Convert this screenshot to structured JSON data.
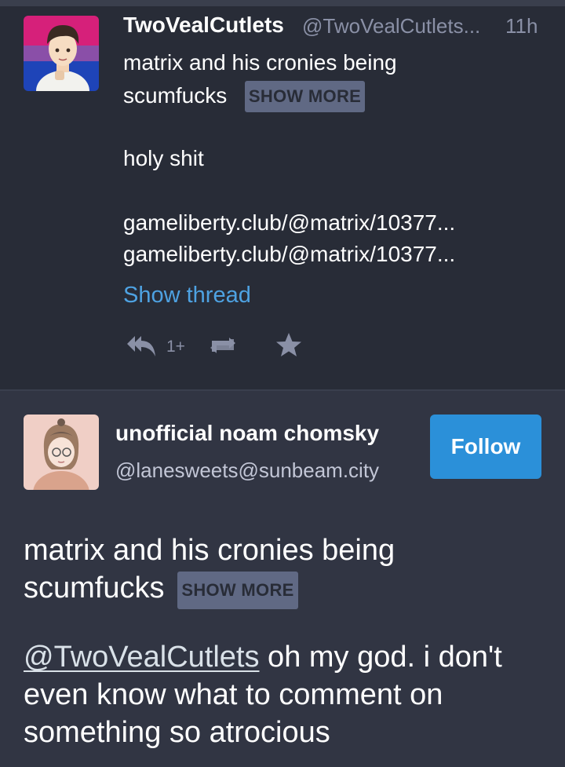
{
  "parent_status": {
    "display_name": "TwoVealCutlets",
    "handle": "@TwoVealCutlets...",
    "time": "11h",
    "cw_line1": "matrix and his cronies being",
    "cw_line2": "scumfucks",
    "show_more": "SHOW MORE",
    "body_line1": "holy shit",
    "link1": "gameliberty.club/@matrix/10377...",
    "link2": "gameliberty.club/@matrix/10377...",
    "show_thread": "Show thread",
    "reply_count": "1+",
    "icons": [
      "reply-all-icon",
      "boost-icon",
      "star-icon"
    ]
  },
  "detailed_status": {
    "display_name": "unofficial noam chomsky",
    "handle": "@lanesweets@sunbeam.city",
    "follow_label": "Follow",
    "cw_line1": "matrix and his cronies being",
    "cw_line2": "scumfucks",
    "show_more": "SHOW MORE",
    "mention": "@TwoVealCutlets",
    "body_line1_rest": " oh my god. i don't",
    "body_line2": "even know what to comment on",
    "body_line3": "something so atrocious"
  },
  "colors": {
    "background": "#282c37",
    "detail_background": "#313543",
    "accent": "#2b90d9",
    "link": "#4ea2e2",
    "muted": "#8a90a6",
    "show_more_bg": "#606984"
  }
}
